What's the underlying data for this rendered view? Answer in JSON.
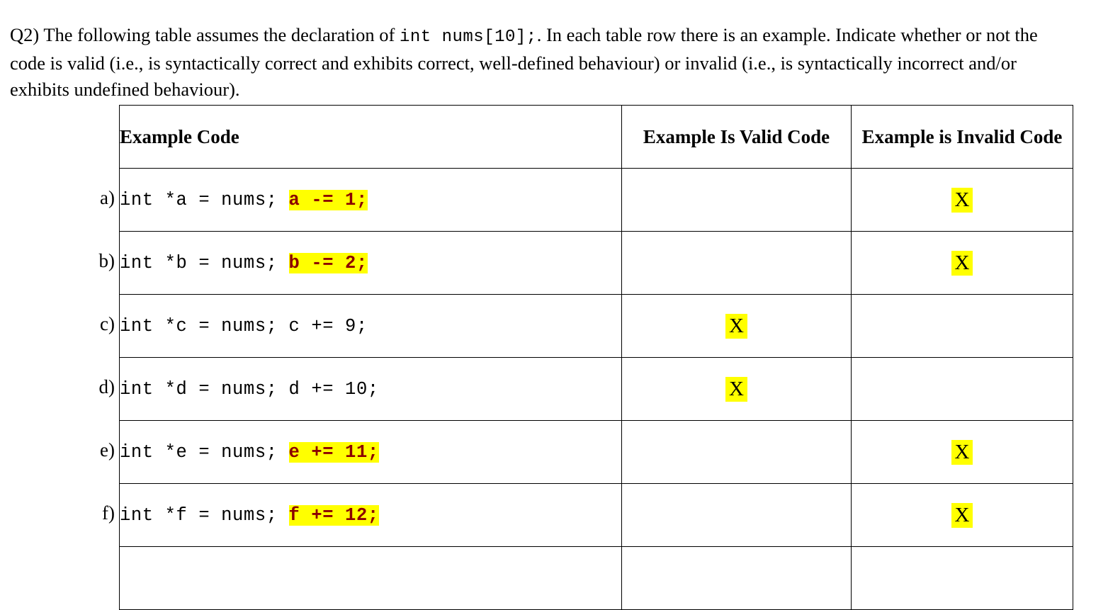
{
  "question": {
    "label": "Q2)",
    "text_before_code": "Q2) The following table assumes the declaration of ",
    "inline_code": "int nums[10];",
    "text_after_code": ". In each table row there is an example. Indicate whether or not the code is valid (i.e., is syntactically correct and exhibits correct, well-defined behaviour) or invalid (i.e., is syntactically incorrect and/or exhibits undefined behaviour)."
  },
  "table": {
    "headers": {
      "code": "Example Code",
      "valid": "Example Is Valid Code",
      "invalid": "Example is Invalid Code"
    },
    "colors": {
      "highlight": "#ffff00",
      "highlight_text": "#8b0000",
      "border": "#000000",
      "text": "#000000"
    },
    "mark_symbol": "X",
    "rows": [
      {
        "label": "a)",
        "code_plain": "int *a = nums; ",
        "code_highlighted": "a -= 1;",
        "valid": "",
        "invalid": "X"
      },
      {
        "label": "b)",
        "code_plain": "int *b = nums; ",
        "code_highlighted": "b -= 2;",
        "valid": "",
        "invalid": "X"
      },
      {
        "label": "c)",
        "code_plain": "int *c = nums; c += 9;",
        "code_highlighted": "",
        "valid": "X",
        "invalid": ""
      },
      {
        "label": "d)",
        "code_plain": "int *d = nums; d += 10;",
        "code_highlighted": "",
        "valid": "X",
        "invalid": ""
      },
      {
        "label": "e)",
        "code_plain": "int *e = nums; ",
        "code_highlighted": "e += 11;",
        "valid": "",
        "invalid": "X"
      },
      {
        "label": "f)",
        "code_plain": "int *f = nums; ",
        "code_highlighted": "f += 12;",
        "valid": "",
        "invalid": "X"
      },
      {
        "label": "",
        "code_plain": "",
        "code_highlighted": "",
        "valid": "",
        "invalid": ""
      }
    ]
  }
}
